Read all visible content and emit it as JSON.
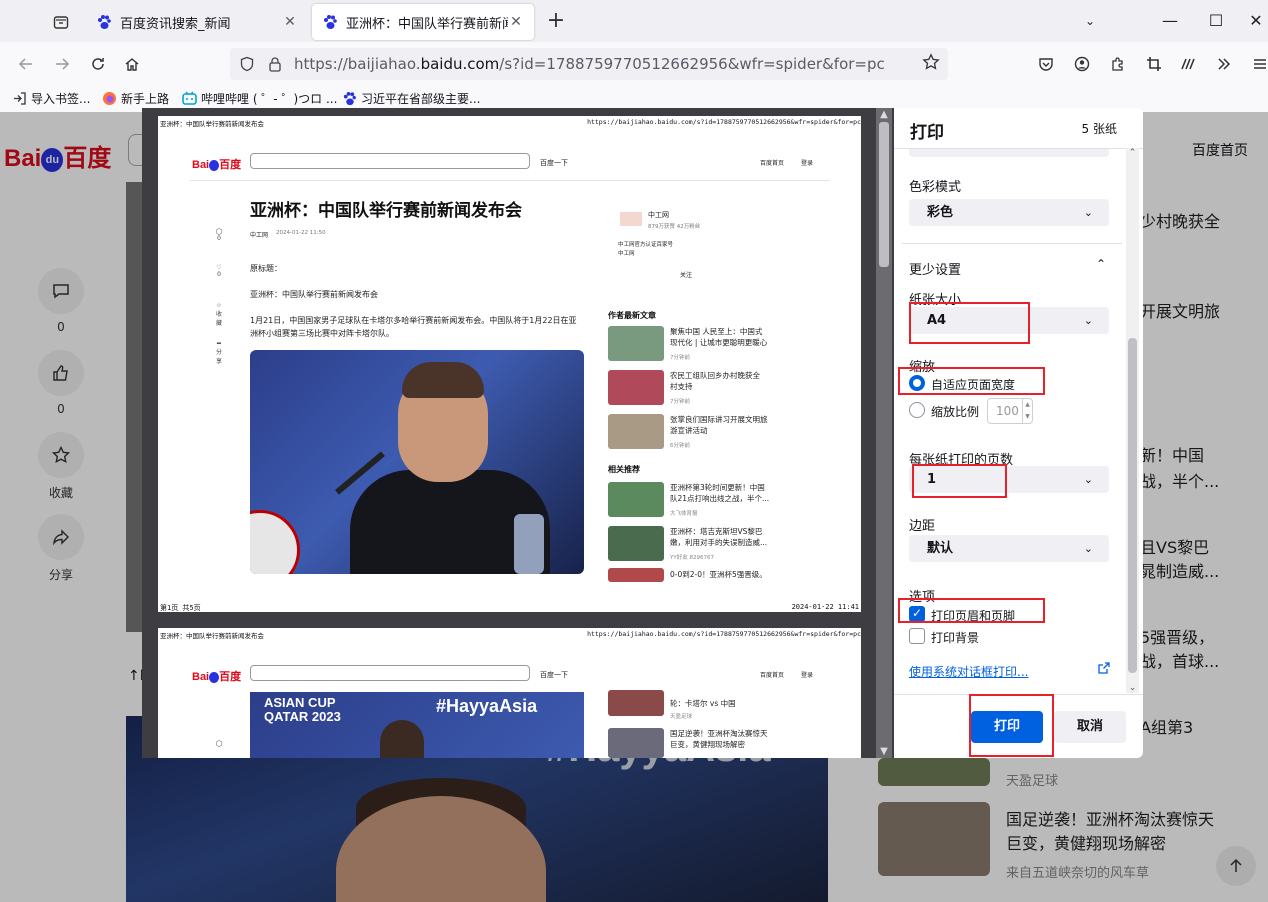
{
  "tabs": [
    {
      "title": "百度资讯搜索_新闻",
      "active": false
    },
    {
      "title": "亚洲杯：中国队举行赛前新闻发",
      "active": true
    }
  ],
  "nav": {
    "url_prefix": "https://baijiahao.",
    "url_host": "baidu.com",
    "url_path": "/s?id=1788759770512662956&wfr=spider&for=pc"
  },
  "bookmarks": [
    "导入书签...",
    "新手上路",
    "哔哩哔哩 ( ゜- ゜)つロ ...",
    "习近平在省部级主要..."
  ],
  "background_page": {
    "logo": "Bai",
    "logo_du": "du",
    "logo_tail": "百度",
    "home_link": "百度首页",
    "actions": [
      {
        "label": "0",
        "icon": "comment-icon"
      },
      {
        "label": "0",
        "icon": "like-icon"
      },
      {
        "label": "收藏",
        "icon": "star-icon"
      },
      {
        "label": "分享",
        "icon": "share-icon"
      }
    ],
    "back_to_top": "↑P",
    "right_texts": [
      "少村晚获全",
      "开展文明旅",
      "新！中国",
      "战，半个...",
      "且VS黎巴",
      "晁制造威...",
      "5强晋级，",
      "战，首球...",
      "A组第3"
    ],
    "right_items": [
      {
        "title": "天盈足球"
      },
      {
        "title_line1": "国足逆袭！亚洲杯淘汰赛惊天",
        "title_line2": "巨变，黄健翔现场解密",
        "source": "来自五道峡奈切的风车草"
      }
    ]
  },
  "preview": {
    "page_header_left": "亚洲杯：中国队举行赛前新闻发布会",
    "page_header_right": "https://baijiahao.baidu.com/s?id=1788759770512662956&wfr=spider&for=pc",
    "mini_logo": "Bai",
    "mini_logo_tail": "百度",
    "search_btn": "百度一下",
    "top_links": [
      "百度首页",
      "登录"
    ],
    "article_title": "亚洲杯：中国队举行赛前新闻发布会",
    "byline_source": "中工网",
    "byline_date": "2024-01-22 11:50",
    "author_name": "中工网",
    "author_meta": "879万获赞 42万粉丝",
    "author_desc_1": "中工网官方认证百家号",
    "author_desc_2": "中工网",
    "follow": "关注",
    "original_title_label": "原标题：",
    "original_title": "亚洲杯：中国队举行赛前新闻发布会",
    "body": "1月21日，中国国家男子足球队在卡塔尔多哈举行赛前新闻发布会。中国队将于1月22日在亚洲杯小组赛第三场比赛中对阵卡塔尔队。",
    "side_counts": [
      "0",
      "0",
      "收藏",
      "分享"
    ],
    "latest_title": "作者最新文章",
    "latest": [
      {
        "t1": "聚焦中国 人民至上：中国式",
        "t2": "现代化 | 让城市更聪明更暖心",
        "s": "7分钟前"
      },
      {
        "t1": "农民工组队回乡办村晚获全",
        "t2": "村支持",
        "s": "7分钟前"
      },
      {
        "t1": "张掌良们国际讲习开展文明旅",
        "t2": "游宣讲活动",
        "s": "6分钟前"
      }
    ],
    "related_title": "相关推荐",
    "related": [
      {
        "t1": "亚洲杯第3轮时间更新！中国",
        "t2": "队21点打响出线之战，半个...",
        "s": "大飞体育报"
      },
      {
        "t1": "亚洲杯：塔吉克斯坦VS黎巴",
        "t2": "嫩，利用对手的失误制造威...",
        "s": "YY好友 8296767"
      },
      {
        "t1": "0-0到2-0！亚洲杯5强晋级。",
        "t2": "",
        "s": ""
      }
    ],
    "footer_left": "第1页 共5页",
    "footer_right": "2024-01-22  11:41",
    "p2_banner_1": "ASIAN CUP",
    "p2_banner_2": "QATAR 2023",
    "p2_hashtag": "#HayyaAsia",
    "p2_related": [
      {
        "t1": "轮：卡塔尔 vs 中国",
        "s": "天盈足球"
      },
      {
        "t1": "国足逆袭！亚洲杯淘汰赛惊天",
        "t2": "巨变，黄健翔现场解密",
        "s": ""
      }
    ]
  },
  "print_panel": {
    "title": "打印",
    "sheet_count": "5 张纸",
    "color_mode_label": "色彩模式",
    "color_mode_value": "彩色",
    "fewer_settings": "更少设置",
    "paper_size_label": "纸张大小",
    "paper_size_value": "A4",
    "scale_label": "缩放",
    "scale_fit": "自适应页面宽度",
    "scale_custom": "缩放比例",
    "scale_value": "100",
    "pages_per_sheet_label": "每张纸打印的页数",
    "pages_per_sheet_value": "1",
    "margins_label": "边距",
    "margins_value": "默认",
    "options_label": "选项",
    "opt_headers": "打印页眉和页脚",
    "opt_background": "打印背景",
    "system_dialog": "使用系统对话框打印...",
    "print_btn": "打印",
    "cancel_btn": "取消"
  },
  "colors": {
    "accent": "#0061e0",
    "annotation": "#e8202a",
    "baidu_red": "#de0a1c",
    "baidu_blue": "#2932e1"
  }
}
